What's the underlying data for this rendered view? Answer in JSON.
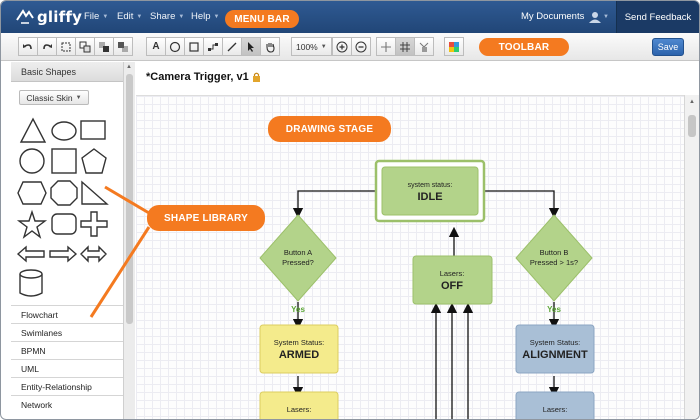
{
  "menubar": {
    "logo_text": "gliffy",
    "items": [
      {
        "label": "File"
      },
      {
        "label": "Edit"
      },
      {
        "label": "Share"
      },
      {
        "label": "Help"
      }
    ],
    "my_documents": "My Documents",
    "send_feedback": "Send Feedback",
    "background_color": "#2a5185"
  },
  "toolbar": {
    "zoom_value": "100%",
    "save_label": "Save"
  },
  "callouts": {
    "menu_bar": "MENU BAR",
    "toolbar": "TOOLBAR",
    "drawing_stage": "DRAWING STAGE",
    "shape_library": "SHAPE LIBRARY",
    "color": "#f47a20"
  },
  "sidebar": {
    "header": "Basic Shapes",
    "skin_select": "Classic Skin",
    "categories": [
      {
        "label": "Flowchart"
      },
      {
        "label": "Swimlanes"
      },
      {
        "label": "BPMN"
      },
      {
        "label": "UML"
      },
      {
        "label": "Entity-Relationship"
      },
      {
        "label": "Network"
      }
    ]
  },
  "document": {
    "title": "*Camera Trigger, v1"
  },
  "diagram": {
    "idle": {
      "line1": "system status:",
      "line2": "IDLE"
    },
    "decision_a": {
      "line1": "Button A",
      "line2": "Pressed?"
    },
    "decision_b": {
      "line1": "Button B",
      "line2": "Pressed > 1s?"
    },
    "lasers_off": {
      "line1": "Lasers:",
      "line2": "OFF"
    },
    "armed": {
      "line1": "System Status:",
      "line2": "ARMED"
    },
    "alignment": {
      "line1": "System Status:",
      "line2": "ALIGNMENT"
    },
    "yes_a": "Yes",
    "yes_b": "Yes",
    "lasers_bottom_left": "Lasers:",
    "lasers_bottom_right": "Lasers:",
    "colors": {
      "green": "#b3d38a",
      "green_border": "#9cc06a",
      "yellow": "#f4eb8c",
      "blue": "#a9bfd6",
      "yes_label": "#5aa534"
    }
  }
}
